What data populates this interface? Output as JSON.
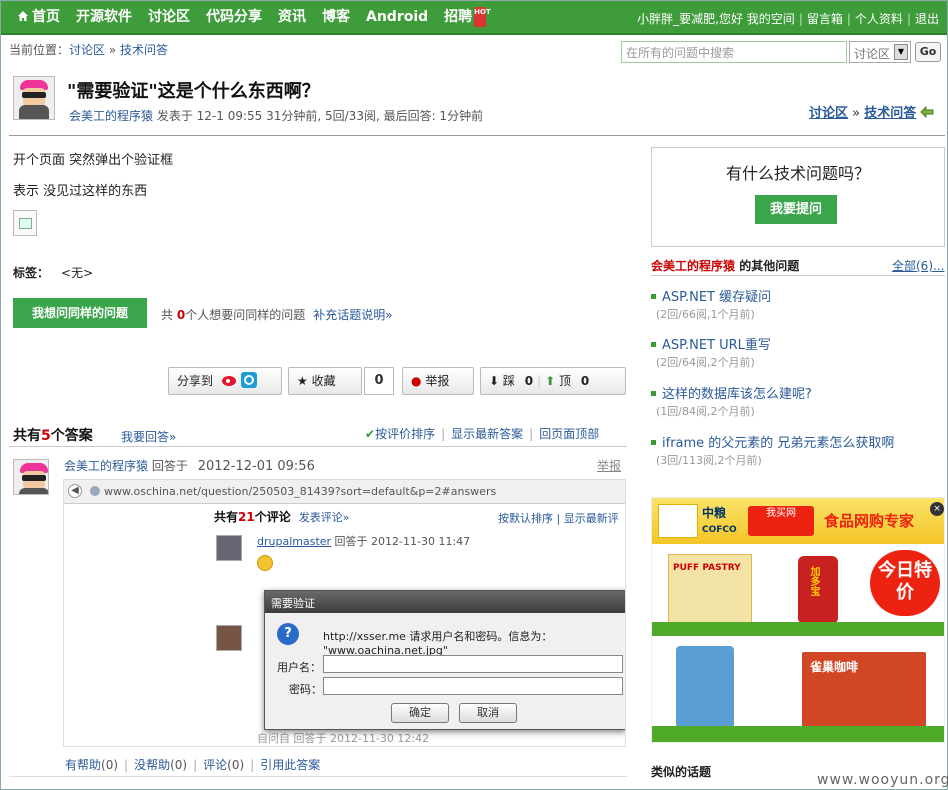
{
  "nav": {
    "items": [
      "首页",
      "开源软件",
      "讨论区",
      "代码分享",
      "资讯",
      "博客",
      "Android",
      "招聘"
    ],
    "hot_badge": "HOT",
    "user": {
      "greeting": "小胖胖_要减肥,您好",
      "links": [
        "我的空间",
        "留言箱",
        "个人资料",
        "退出"
      ]
    }
  },
  "breadcrumb": {
    "prefix": "当前位置：",
    "items": [
      "讨论区",
      "技术问答"
    ],
    "sep": "»"
  },
  "search": {
    "placeholder": "在所有的问题中搜索",
    "scope": "讨论区",
    "go": "Go"
  },
  "question": {
    "title": "\"需要验证\"这是个什么东西啊？",
    "author": "会美工的程序猿",
    "meta": "发表于 12-1 09:55 31分钟前, 5回/33阅, 最后回答: 1分钟前",
    "body": [
      "开个页面 突然弹出个验证框",
      "表示 没见过这样的东西"
    ],
    "tags_label": "标签：",
    "tags_value": "<无>",
    "same_button": "我想问同样的问题",
    "same_prefix": "共",
    "same_count": "0",
    "same_suffix": "个人想要问同样的问题",
    "supplement": "补充话题说明»"
  },
  "right_crumb": {
    "a": "讨论区",
    "sep": "»",
    "b": "技术问答"
  },
  "actions": {
    "share": "分享到",
    "favorite": "收藏",
    "favorite_count": "0",
    "report": "举报",
    "down": "踩",
    "down_count": "0",
    "up": "顶",
    "up_count": "0"
  },
  "answers": {
    "prefix": "共有",
    "count": "5",
    "suffix": "个答案",
    "reply": "我要回答»",
    "sort": [
      "按评价排序",
      "显示最新答案",
      "回页面顶部"
    ],
    "first": {
      "author": "会美工的程序猿",
      "verb": "回答于",
      "datetime": "2012-12-01 09:56",
      "report": "举报",
      "actions": [
        {
          "label": "有帮助",
          "count": "(0)"
        },
        {
          "label": "没帮助",
          "count": "(0)"
        },
        {
          "label": "评论",
          "count": "(0)"
        },
        {
          "label": "引用此答案",
          "count": ""
        }
      ]
    }
  },
  "embedded": {
    "url": "www.oschina.net/question/250503_81439?sort=default&p=2#answers",
    "comments_prefix": "共有",
    "comments_count": "21",
    "comments_suffix": "个评论",
    "post_comment": "发表评论»",
    "sort": "按默认排序 | 显示最新评",
    "user1": "drupalmaster",
    "user1_meta": "回答于 2012-11-30 11:47",
    "foot": "自问自 回答于 2012-11-30 12:42",
    "dialog": {
      "title": "需要验证",
      "message": "http://xsser.me 请求用户名和密码。信息为： \"www.oachina.net.jpg\"",
      "user_label": "用户名：",
      "pass_label": "密码：",
      "ok": "确定",
      "cancel": "取消"
    }
  },
  "sidebar": {
    "ask": {
      "title": "有什么技术问题吗？",
      "button": "我要提问"
    },
    "other": {
      "user": "会美工的程序猿",
      "suffix": "的其他问题",
      "all": "全部(6)..."
    },
    "questions": [
      {
        "title": "ASP.NET 缓存疑问",
        "meta": "(2回/66阅,1个月前)"
      },
      {
        "title": "ASP.NET URL重写",
        "meta": "(2回/64阅,2个月前)"
      },
      {
        "title": "这样的数据库该怎么建呢?",
        "meta": "(1回/84阅,2个月前)"
      },
      {
        "title": "iframe 的父元素的 兄弟元素怎么获取啊",
        "meta": "(3回/113阅,2个月前)"
      }
    ],
    "ad": {
      "brand": "中粮",
      "brand_en": "COFCO",
      "buy": "我买网",
      "slogan": "食品网购专家",
      "burst": "今日特价",
      "puff": "PUFF PASTRY",
      "can": "加多宝",
      "coffee": "雀巢咖啡"
    },
    "similar": "类似的话题"
  },
  "watermark": "www.wooyun.org",
  "colors": {
    "nav_green": "#3e9c3a",
    "button_green": "#3ba54c",
    "link": "#2a5a9a",
    "accent_red": "#cc0000"
  }
}
